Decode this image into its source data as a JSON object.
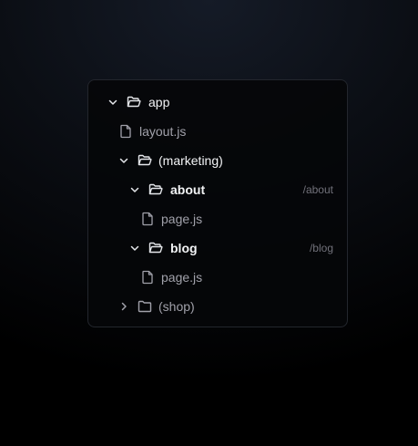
{
  "colors": {
    "panel_border": "#23262d",
    "open_folder_text": "#f3f4f6",
    "muted_text": "#a1a1aa",
    "route_text": "#71717a"
  },
  "tree": {
    "app": {
      "label": "app",
      "icon": "folder-open-icon",
      "expanded": true
    },
    "layout": {
      "label": "layout.js",
      "icon": "file-icon"
    },
    "marketing": {
      "label": "(marketing)",
      "icon": "folder-open-icon",
      "expanded": true
    },
    "about": {
      "label": "about",
      "icon": "folder-open-icon",
      "expanded": true,
      "route": "/about"
    },
    "about_page": {
      "label": "page.js",
      "icon": "file-icon"
    },
    "blog": {
      "label": "blog",
      "icon": "folder-open-icon",
      "expanded": true,
      "route": "/blog"
    },
    "blog_page": {
      "label": "page.js",
      "icon": "file-icon"
    },
    "shop": {
      "label": "(shop)",
      "icon": "folder-closed-icon",
      "expanded": false
    }
  }
}
